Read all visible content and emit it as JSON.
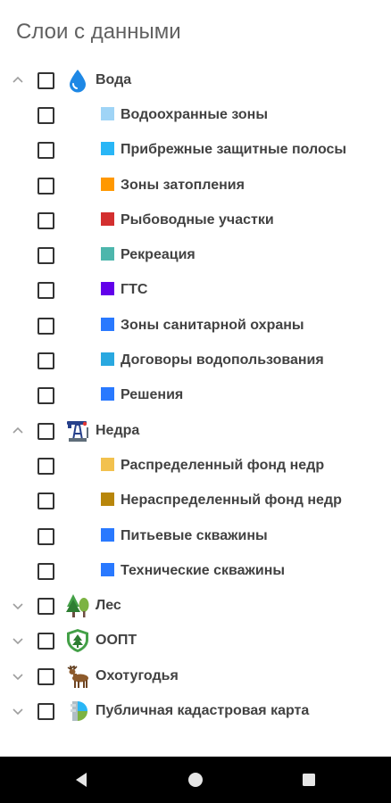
{
  "title": "Слои с данными",
  "groups": [
    {
      "label": "Вода",
      "icon": "water-drop-icon",
      "expanded": true,
      "items": [
        {
          "label": "Водоохранные зоны",
          "color": "#9fd4f6"
        },
        {
          "label": "Прибрежные защитные полосы",
          "color": "#29b6f6"
        },
        {
          "label": "Зоны затопления",
          "color": "#ff9800"
        },
        {
          "label": "Рыбоводные участки",
          "color": "#d32f2f"
        },
        {
          "label": "Рекреация",
          "color": "#4db6ac"
        },
        {
          "label": "ГТС",
          "color": "#6200ea"
        },
        {
          "label": "Зоны санитарной охраны",
          "color": "#2979ff"
        },
        {
          "label": "Договоры водопользования",
          "color": "#29a8e0"
        },
        {
          "label": "Решения",
          "color": "#2979ff"
        }
      ]
    },
    {
      "label": "Недра",
      "icon": "oil-pump-icon",
      "expanded": true,
      "items": [
        {
          "label": "Распределенный фонд недр",
          "color": "#f2c14e"
        },
        {
          "label": "Нераспределенный фонд недр",
          "color": "#b8860b"
        },
        {
          "label": "Питьевые скважины",
          "color": "#2979ff"
        },
        {
          "label": "Технические скважины",
          "color": "#2979ff"
        }
      ]
    },
    {
      "label": "Лес",
      "icon": "forest-trees-icon",
      "expanded": false,
      "items": []
    },
    {
      "label": "ООПТ",
      "icon": "protected-area-shield-icon",
      "expanded": false,
      "items": []
    },
    {
      "label": "Охотугодья",
      "icon": "deer-icon",
      "expanded": false,
      "items": []
    },
    {
      "label": "Публичная кадастровая карта",
      "icon": "cadastral-map-icon",
      "expanded": false,
      "items": []
    }
  ],
  "system_nav": {
    "back": "back-triangle-icon",
    "home": "home-circle-icon",
    "recents": "recents-square-icon"
  }
}
